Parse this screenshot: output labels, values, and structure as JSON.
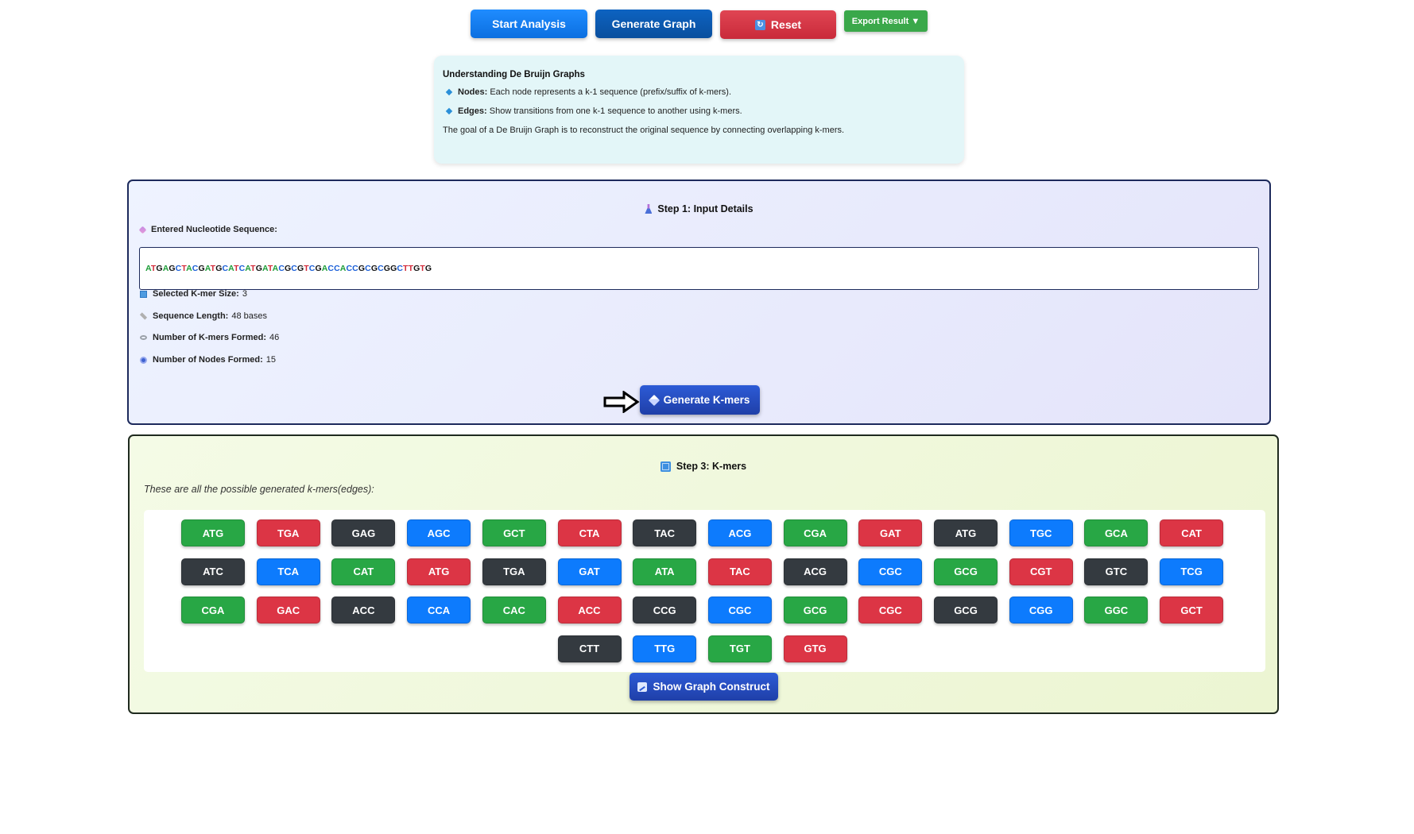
{
  "toolbar": {
    "start_label": "Start Analysis",
    "graph_label": "Generate Graph",
    "reset_label": "Reset",
    "reset_icon": "↻",
    "export_label": "Export Result ▼"
  },
  "info": {
    "title": "Understanding De Bruijn Graphs",
    "nodes_label": "Nodes:",
    "nodes_text": "Each node represents a k-1 sequence (prefix/suffix of k-mers).",
    "edges_label": "Edges:",
    "edges_text": "Show transitions from one k-1 sequence to another using k-mers.",
    "goal_text": "The goal of a De Bruijn Graph is to reconstruct the original sequence by connecting overlapping k-mers."
  },
  "step1": {
    "title": "Step 1: Input Details",
    "sequence_label": "Entered Nucleotide Sequence:",
    "sequence": "ATGAGCTACGATGCATCATGATACGCGTCGACCACCGCGCGGCTTGTG",
    "kmer_size_label": "Selected K-mer Size:",
    "kmer_size_value": "3",
    "length_label": "Sequence Length:",
    "length_value": "48 bases",
    "kmers_formed_label": "Number of K-mers Formed:",
    "kmers_formed_value": "46",
    "nodes_formed_label": "Number of Nodes Formed:",
    "nodes_formed_value": "15",
    "generate_label": "Generate K-mers"
  },
  "step3": {
    "title": "Step 3: K-mers",
    "description": "These are all the possible generated k-mers(edges):",
    "show_graph_label": "Show Graph Construct",
    "kmers": [
      {
        "label": "ATG",
        "color": "green"
      },
      {
        "label": "TGA",
        "color": "red"
      },
      {
        "label": "GAG",
        "color": "dark"
      },
      {
        "label": "AGC",
        "color": "blue"
      },
      {
        "label": "GCT",
        "color": "green"
      },
      {
        "label": "CTA",
        "color": "red"
      },
      {
        "label": "TAC",
        "color": "dark"
      },
      {
        "label": "ACG",
        "color": "blue"
      },
      {
        "label": "CGA",
        "color": "green"
      },
      {
        "label": "GAT",
        "color": "red"
      },
      {
        "label": "ATG",
        "color": "dark"
      },
      {
        "label": "TGC",
        "color": "blue"
      },
      {
        "label": "GCA",
        "color": "green"
      },
      {
        "label": "CAT",
        "color": "red"
      },
      {
        "label": "ATC",
        "color": "dark"
      },
      {
        "label": "TCA",
        "color": "blue"
      },
      {
        "label": "CAT",
        "color": "green"
      },
      {
        "label": "ATG",
        "color": "red"
      },
      {
        "label": "TGA",
        "color": "dark"
      },
      {
        "label": "GAT",
        "color": "blue"
      },
      {
        "label": "ATA",
        "color": "green"
      },
      {
        "label": "TAC",
        "color": "red"
      },
      {
        "label": "ACG",
        "color": "dark"
      },
      {
        "label": "CGC",
        "color": "blue"
      },
      {
        "label": "GCG",
        "color": "green"
      },
      {
        "label": "CGT",
        "color": "red"
      },
      {
        "label": "GTC",
        "color": "dark"
      },
      {
        "label": "TCG",
        "color": "blue"
      },
      {
        "label": "CGA",
        "color": "green"
      },
      {
        "label": "GAC",
        "color": "red"
      },
      {
        "label": "ACC",
        "color": "dark"
      },
      {
        "label": "CCA",
        "color": "blue"
      },
      {
        "label": "CAC",
        "color": "green"
      },
      {
        "label": "ACC",
        "color": "red"
      },
      {
        "label": "CCG",
        "color": "dark"
      },
      {
        "label": "CGC",
        "color": "blue"
      },
      {
        "label": "GCG",
        "color": "green"
      },
      {
        "label": "CGC",
        "color": "red"
      },
      {
        "label": "GCG",
        "color": "dark"
      },
      {
        "label": "CGG",
        "color": "blue"
      },
      {
        "label": "GGC",
        "color": "green"
      },
      {
        "label": "GCT",
        "color": "red"
      },
      {
        "label": "CTT",
        "color": "dark"
      },
      {
        "label": "TTG",
        "color": "blue"
      },
      {
        "label": "TGT",
        "color": "green"
      },
      {
        "label": "GTG",
        "color": "red"
      }
    ]
  },
  "colors": {
    "green": "#28a745",
    "red": "#dc3545",
    "dark": "#343a40",
    "blue": "#0d7bfd"
  }
}
